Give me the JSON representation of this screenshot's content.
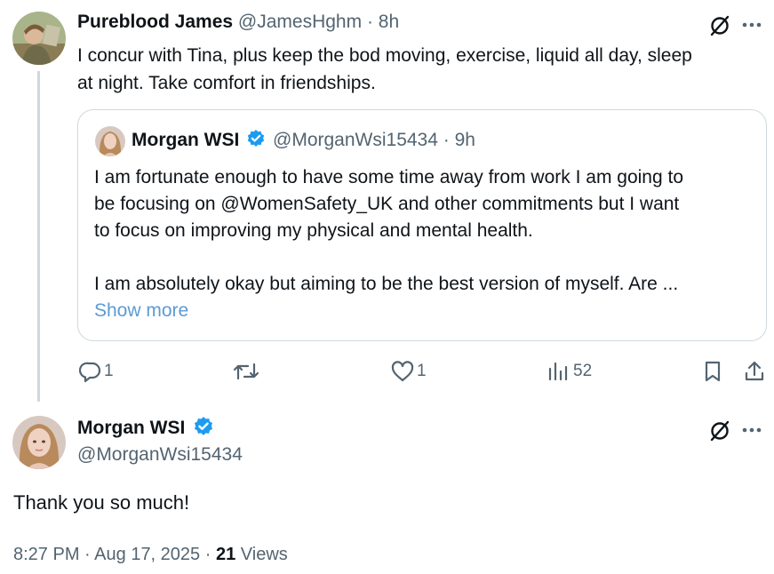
{
  "reply_post": {
    "author_name": "Pureblood James",
    "handle": "@JamesHghm",
    "separator": "·",
    "time": "8h",
    "text_line1": "I concur with Tina, plus keep the bod moving, exercise, liquid all day, sleep",
    "text_line2": "at night.  Take comfort in friendships.",
    "quoted": {
      "author_name": "Morgan WSI",
      "handle": "@MorganWsi15434",
      "separator": "·",
      "time": "9h",
      "lines": [
        "I am fortunate enough to have some time away from work I am going to",
        "be focusing on @WomenSafety_UK and other commitments but I want",
        "to focus on improving my physical and mental health.",
        "I am absolutely okay but aiming to be the best version of myself. Are ..."
      ],
      "show_more": "Show more"
    },
    "actions": {
      "replies": "1",
      "likes": "1",
      "views": "52"
    }
  },
  "main_post": {
    "author_name": "Morgan WSI",
    "handle": "@MorganWsi15434",
    "text": "Thank you so much!",
    "time": "8:27 PM",
    "date": "Aug 17, 2025",
    "views_count": "21",
    "views_label": "Views",
    "separator": "·"
  },
  "colors": {
    "accent": "#1d9bf0",
    "link": "#5b9bd5",
    "text": "#0f1419",
    "muted": "#536471",
    "border": "#cfd9de"
  },
  "icons": [
    "grok-slash-icon",
    "more-icon",
    "reply-icon",
    "retweet-icon",
    "like-icon",
    "views-icon",
    "bookmark-icon",
    "share-icon",
    "verified-badge-icon"
  ]
}
